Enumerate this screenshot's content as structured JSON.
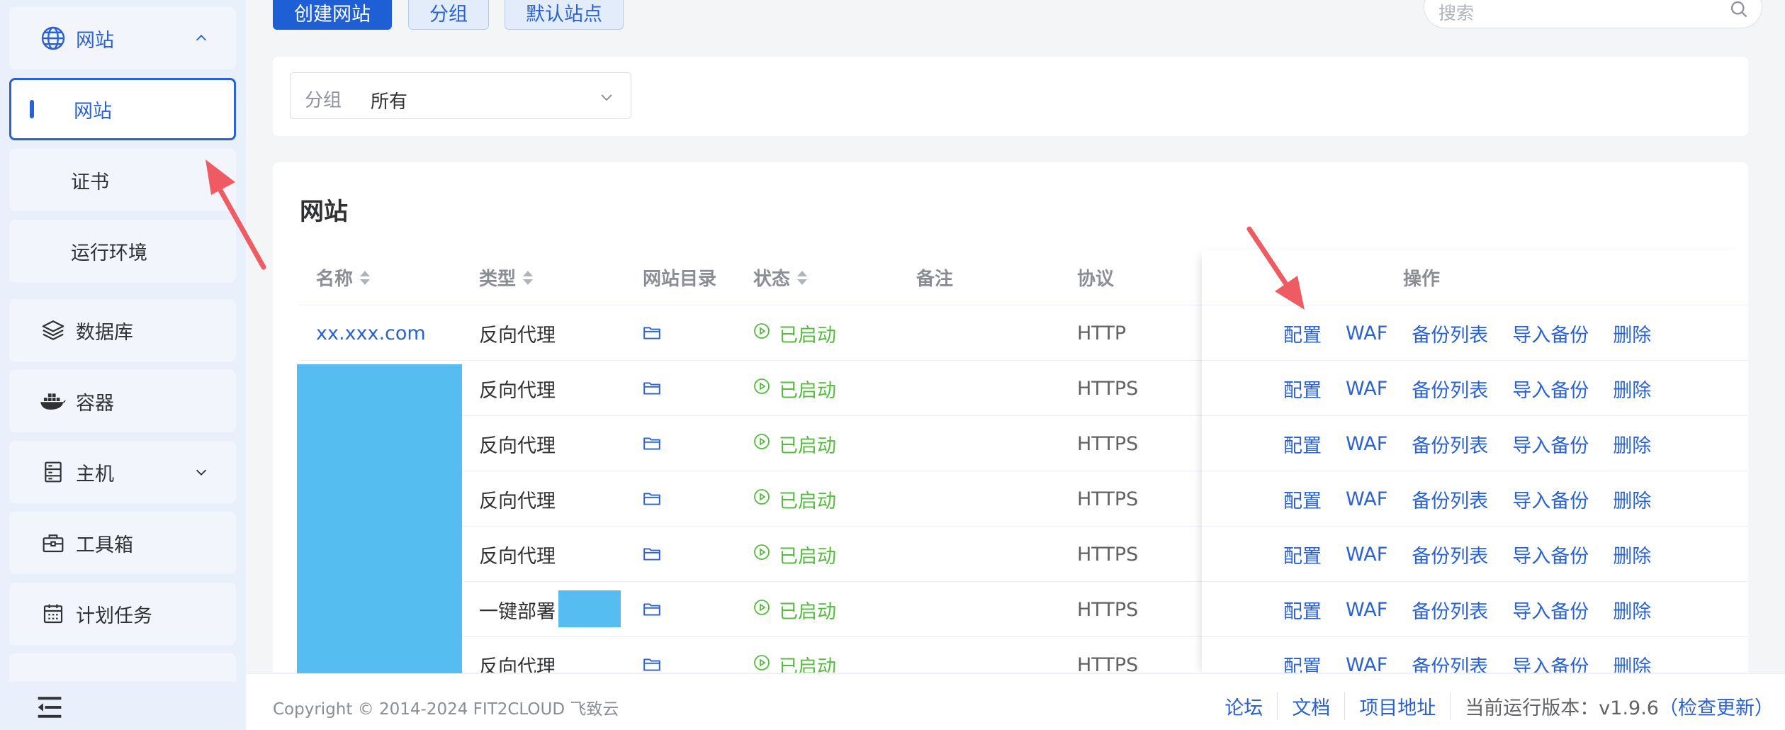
{
  "sidebar": {
    "items": [
      {
        "label": "网站",
        "icon": "globe-icon",
        "expanded": true
      },
      {
        "label": "网站",
        "active": true
      },
      {
        "label": "证书"
      },
      {
        "label": "运行环境"
      },
      {
        "label": "数据库",
        "icon": "layers-icon"
      },
      {
        "label": "容器",
        "icon": "docker-icon"
      },
      {
        "label": "主机",
        "icon": "server-icon"
      },
      {
        "label": "工具箱",
        "icon": "toolbox-icon"
      },
      {
        "label": "计划任务",
        "icon": "calendar-icon"
      }
    ]
  },
  "toolbar": {
    "create_label": "创建网站",
    "group_label": "分组",
    "default_site_label": "默认站点",
    "search_placeholder": "搜索"
  },
  "filter": {
    "prefix": "分组",
    "value": "所有"
  },
  "section_title": "网站",
  "table": {
    "headers": {
      "name": "名称",
      "type": "类型",
      "dir": "网站目录",
      "status": "状态",
      "remark": "备注",
      "protocol": "协议",
      "ops": "操作"
    },
    "rows": [
      {
        "name": "xx.xxx.com",
        "type": "反向代理",
        "status": "已启动",
        "protocol": "HTTP"
      },
      {
        "name": "",
        "type": "反向代理",
        "status": "已启动",
        "protocol": "HTTPS"
      },
      {
        "name": "",
        "type": "反向代理",
        "status": "已启动",
        "protocol": "HTTPS"
      },
      {
        "name": "",
        "type": "反向代理",
        "status": "已启动",
        "protocol": "HTTPS"
      },
      {
        "name": "",
        "type": "反向代理",
        "status": "已启动",
        "protocol": "HTTPS"
      },
      {
        "name": "",
        "type": "一键部署",
        "status": "已启动",
        "protocol": "HTTPS"
      },
      {
        "name": "",
        "type": "反向代理",
        "status": "已启动",
        "protocol": "HTTPS"
      }
    ],
    "actions": {
      "config": "配置",
      "waf": "WAF",
      "backup_list": "备份列表",
      "import_backup": "导入备份",
      "delete": "删除"
    }
  },
  "footer": {
    "copyright": "Copyright © 2014-2024 FIT2CLOUD 飞致云",
    "forum": "论坛",
    "docs": "文档",
    "project": "项目地址",
    "version_label": "当前运行版本：v1.9.6",
    "check_update": "（检查更新）"
  },
  "colors": {
    "primary": "#1f5fd6",
    "link": "#2a62d3",
    "running": "#55bd3d",
    "redaction": "#55bdef",
    "arrow": "#ef5b62"
  }
}
